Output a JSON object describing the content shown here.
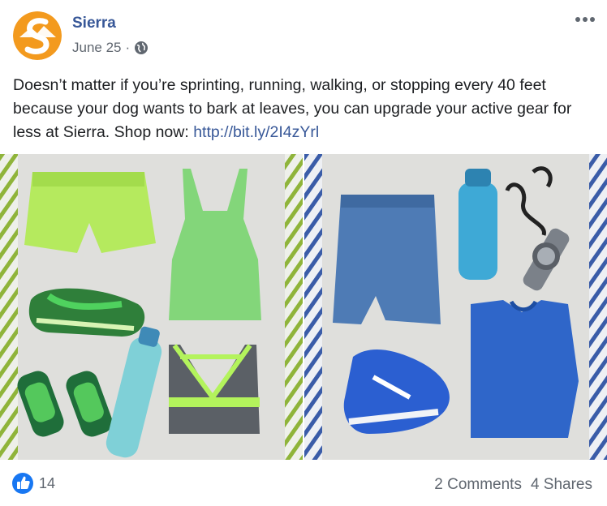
{
  "post": {
    "page_name": "Sierra",
    "date": "June 25",
    "separator": "·",
    "text": "Doesn’t matter if you’re sprinting, running, walking, or stopping every 40 feet because your dog wants to bark at leaves, you can upgrade your active gear for less at Sierra. Shop now: ",
    "link": "http://bit.ly/2I4zYrl"
  },
  "icons": {
    "avatar": "sierra-logo",
    "audience": "globe-icon",
    "menu": "more-options-icon",
    "reaction": "like-icon"
  },
  "colors": {
    "link": "#385898",
    "brand_orange": "#f39a1e",
    "like_blue": "#1877f2",
    "muted_text": "#606770"
  },
  "photos": [
    {
      "theme": "green women's running gear"
    },
    {
      "theme": "blue men's running gear"
    }
  ],
  "footer": {
    "reaction_count": "14",
    "comments": "2 Comments",
    "shares": "4 Shares"
  }
}
